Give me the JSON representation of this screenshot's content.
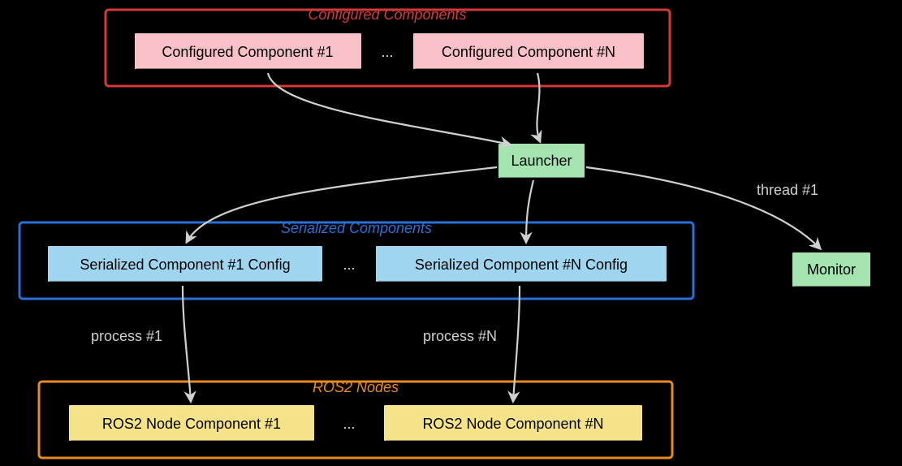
{
  "groups": {
    "configured": {
      "title": "Configured Components",
      "title_color": "#d43a3a",
      "border_color": "#d43a3a"
    },
    "serialized": {
      "title": "Serialized Components",
      "title_color": "#2a6fd6",
      "border_color": "#2a6fd6"
    },
    "ros2": {
      "title": "ROS2 Nodes",
      "title_color": "#e78a1f",
      "border_color": "#e78a1f"
    }
  },
  "nodes": {
    "conf1": {
      "label": "Configured Component #1",
      "fill": "#f7c1c7"
    },
    "confN": {
      "label": "Configured Component #N",
      "fill": "#f7c1c7"
    },
    "launcher": {
      "label": "Launcher",
      "fill": "#a3e4b1"
    },
    "ser1": {
      "label": "Serialized Component #1 Config",
      "fill": "#9fd5ef"
    },
    "serN": {
      "label": "Serialized Component #N Config",
      "fill": "#9fd5ef"
    },
    "ros1": {
      "label": "ROS2 Node Component #1",
      "fill": "#f5e38a"
    },
    "rosN": {
      "label": "ROS2 Node Component #N",
      "fill": "#f5e38a"
    },
    "monitor": {
      "label": "Monitor",
      "fill": "#a3e4b1"
    }
  },
  "edges": {
    "thread1": "thread #1",
    "process1": "process #1",
    "processN": "process #N"
  },
  "ellipsis": "..."
}
